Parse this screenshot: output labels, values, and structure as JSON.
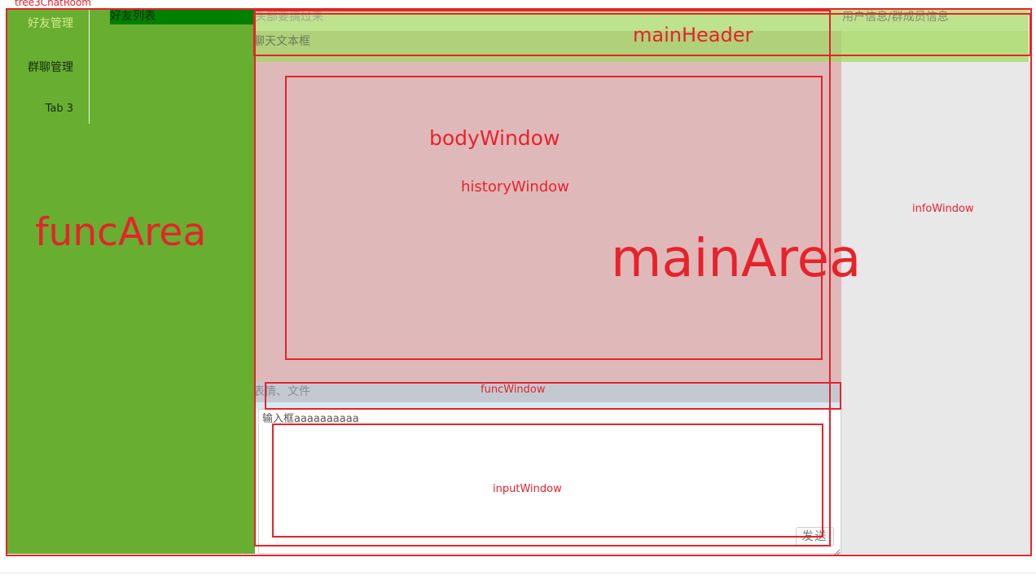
{
  "app": {
    "title": "tree3ChatRoom"
  },
  "func_area": {
    "tabs": [
      {
        "label": "好友管理",
        "active": true
      },
      {
        "label": "群聊管理",
        "active": false
      },
      {
        "label": "Tab 3",
        "active": false
      }
    ],
    "friend_list_header": "好友列表"
  },
  "main_header": {
    "title": "头部要搞过来",
    "chat_text_label": "聊天文本框",
    "user_info_label": "用户信息/群成员信息"
  },
  "func_window": {
    "label": "表情、文件"
  },
  "input_window": {
    "value": "输入框aaaaaaaaaa",
    "send_label": "发送"
  },
  "annotations": {
    "func_area": "funcArea",
    "main_header": "mainHeader",
    "body_window": "bodyWindow",
    "history_window": "historyWindow",
    "main_area": "mainArea",
    "info_window": "infoWindow",
    "func_window": "funcWindow",
    "input_window": "inputWindow"
  },
  "colors": {
    "func_area_bg": "#67ae31",
    "friend_list_header_bg": "#008000",
    "main_area_bg": "#dfb9b9",
    "main_header_bg": "#bde38f",
    "info_window_bg": "#e8e8e8",
    "func_window_bg": "#c4c9d1",
    "annotation_red": "#e8222b"
  }
}
